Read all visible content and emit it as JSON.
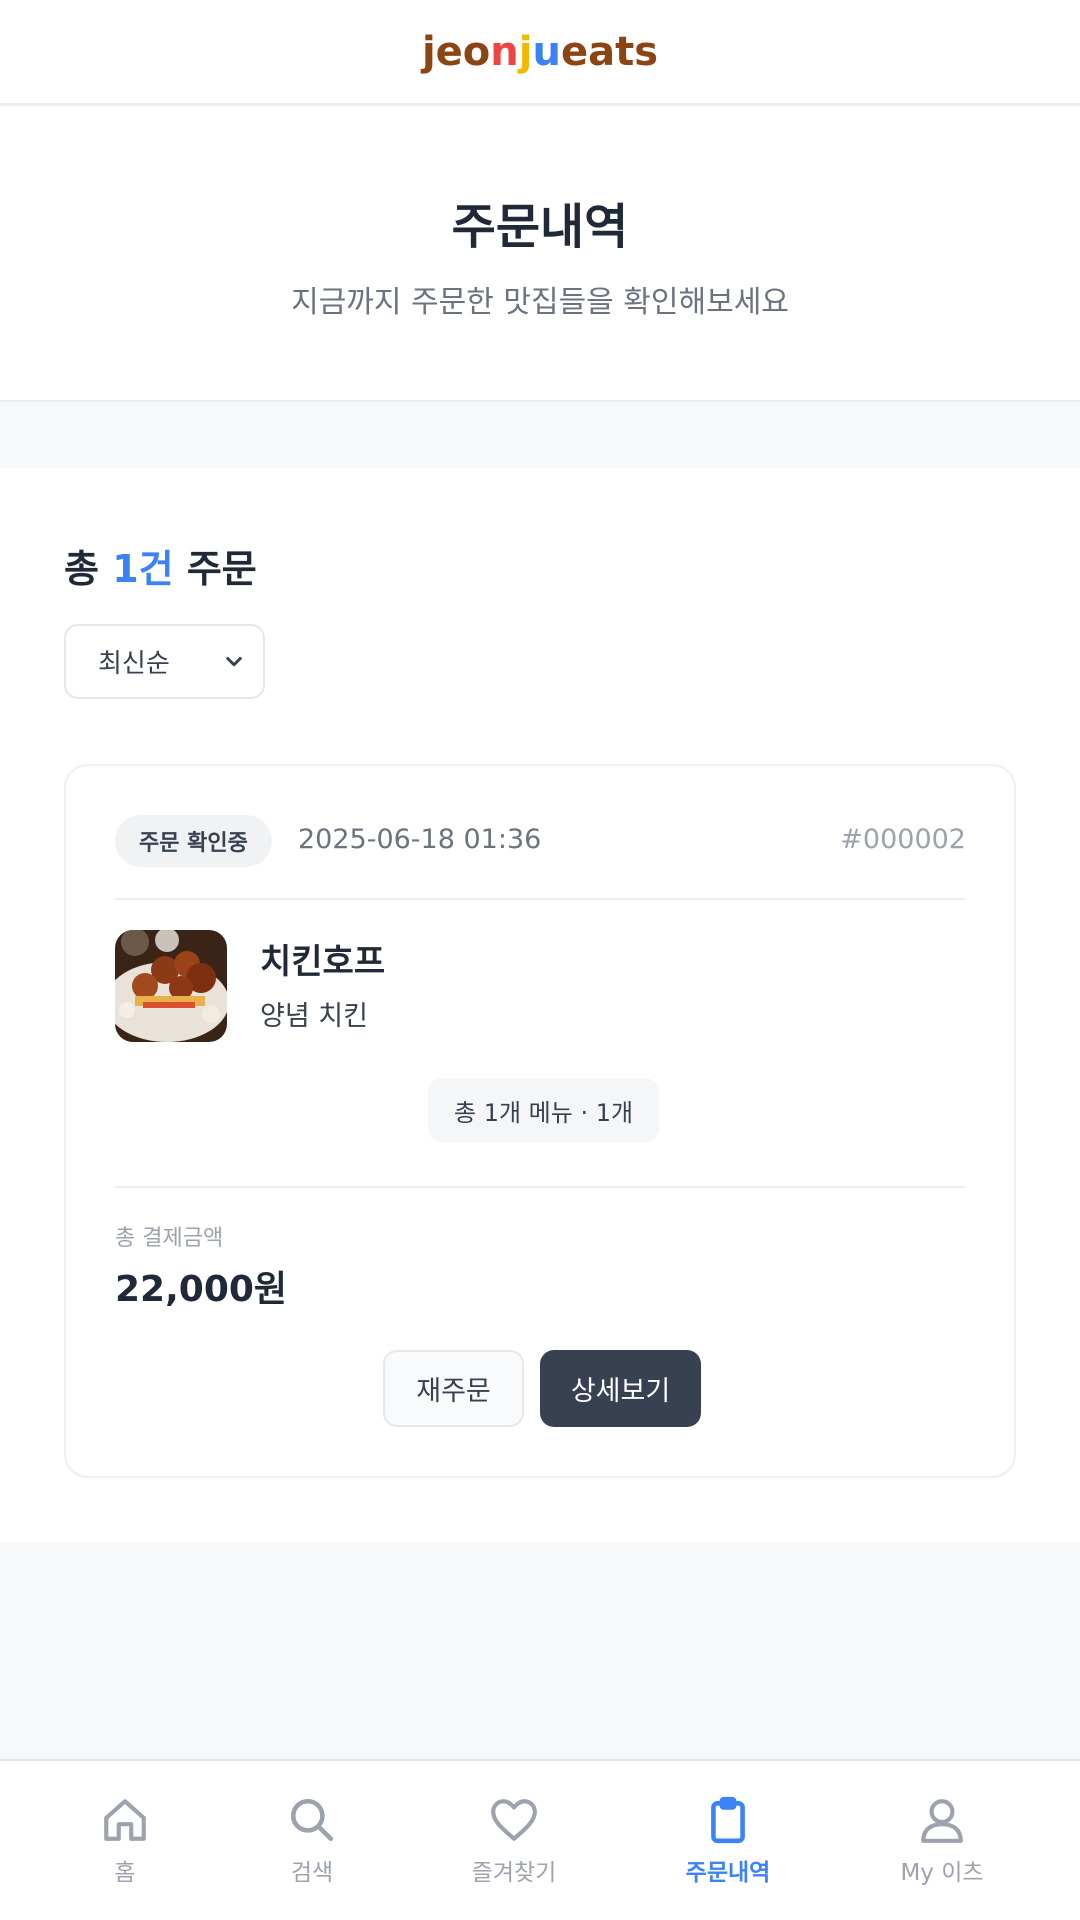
{
  "header": {
    "logo": [
      {
        "ch": "j",
        "color": "#8b4513"
      },
      {
        "ch": "e",
        "color": "#8b4513"
      },
      {
        "ch": "o",
        "color": "#8b4513"
      },
      {
        "ch": "n",
        "color": "#ef4444"
      },
      {
        "ch": "j",
        "color": "#f5b800"
      },
      {
        "ch": "u",
        "color": "#3b82f6"
      },
      {
        "ch": "e",
        "color": "#8b4513"
      },
      {
        "ch": "a",
        "color": "#8b4513"
      },
      {
        "ch": "t",
        "color": "#8b4513"
      },
      {
        "ch": "s",
        "color": "#8b4513"
      }
    ]
  },
  "hero": {
    "title": "주문내역",
    "subtitle": "지금까지 주문한 맛집들을 확인해보세요"
  },
  "summary": {
    "prefix": "총 ",
    "count": "1건",
    "suffix": " 주문"
  },
  "sort": {
    "selected": "최신순"
  },
  "order": {
    "status": "주문 확인중",
    "datetime": "2025-06-18 01:36",
    "order_no": "#000002",
    "store_name": "치킨호프",
    "menu": "양념 치킨",
    "menu_summary": "총 1개 메뉴 · 1개",
    "total_label": "총 결제금액",
    "total_amount": "22,000원",
    "reorder_label": "재주문",
    "detail_label": "상세보기"
  },
  "nav": {
    "items": [
      {
        "label": "홈",
        "icon": "home-icon"
      },
      {
        "label": "검색",
        "icon": "search-icon"
      },
      {
        "label": "즐겨찾기",
        "icon": "heart-icon"
      },
      {
        "label": "주문내역",
        "icon": "clipboard-icon"
      },
      {
        "label": "My 이츠",
        "icon": "user-icon"
      }
    ],
    "active_index": 3
  },
  "colors": {
    "accent": "#3b82f6",
    "dark_button": "#374151"
  }
}
